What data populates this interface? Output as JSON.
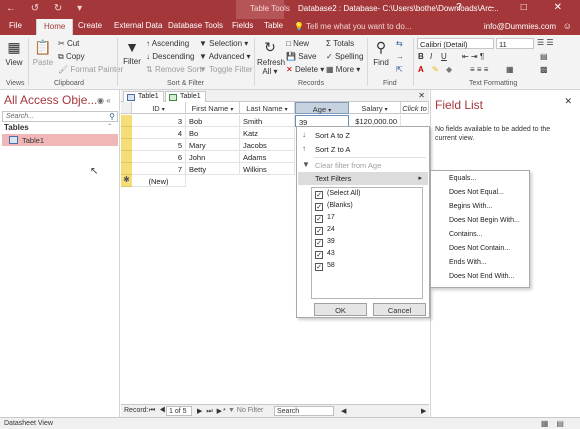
{
  "titlebar": {
    "quick_access": "← ↺ ↻ ▾",
    "tool_context": "Table Tools",
    "window_title": "Database2 : Database- C:\\Users\\bothe\\Downloads\\Arc...",
    "window_controls": "? – □ ✕"
  },
  "tabs": {
    "file": "File",
    "home": "Home",
    "create": "Create",
    "external": "External Data",
    "dbtools": "Database Tools",
    "fields": "Fields",
    "table": "Table",
    "tell": "Tell me what you want to do...",
    "email": "info@Dummies.com"
  },
  "ribbon": {
    "views": {
      "view": "View",
      "group": "Views"
    },
    "clipboard": {
      "paste": "Paste",
      "cut": "Cut",
      "copy": "Copy",
      "format_painter": "Format Painter",
      "group": "Clipboard"
    },
    "sortfilter": {
      "filter": "Filter",
      "ascending": "Ascending",
      "descending": "Descending",
      "remove_sort": "Remove Sort",
      "selection": "Selection ▾",
      "advanced": "Advanced ▾",
      "toggle_filter": "Toggle Filter",
      "group": "Sort & Filter"
    },
    "records": {
      "refresh": "Refresh All ▾",
      "new": "New",
      "save": "Save",
      "delete": "Delete ▾",
      "totals": "Totals",
      "spelling": "Spelling",
      "more": "More ▾",
      "group": "Records"
    },
    "find": {
      "find": "Find",
      "group": "Find"
    },
    "textformat": {
      "font": "Calibri (Detail)",
      "size": "11",
      "group": "Text Formatting"
    }
  },
  "navpane": {
    "title": "All Access Obje...",
    "search_placeholder": "Search...",
    "section": "Tables",
    "item": "Table1"
  },
  "doctabs": {
    "tab1": "Table1",
    "tab2": "Table1"
  },
  "datasheet": {
    "columns": [
      "ID",
      "First Name",
      "Last Name",
      "Age",
      "Salary",
      "Click to"
    ],
    "rows": [
      {
        "id": "3",
        "first": "Bob",
        "last": "Smith",
        "age": "39",
        "salary": "$120,000.00"
      },
      {
        "id": "4",
        "first": "Bo",
        "last": "Katz",
        "age": "",
        "salary": ""
      },
      {
        "id": "5",
        "first": "Mary",
        "last": "Jacobs",
        "age": "",
        "salary": ""
      },
      {
        "id": "6",
        "first": "John",
        "last": "Adams",
        "age": "",
        "salary": ""
      },
      {
        "id": "7",
        "first": "Betty",
        "last": "Wilkins",
        "age": "",
        "salary": ""
      }
    ],
    "new_row": "(New)",
    "new_row_marker": "✱"
  },
  "recnav": {
    "label": "Record:",
    "position": "1 of 5",
    "nofilter": "No Filter",
    "search": "Search"
  },
  "filtermenu": {
    "sort_az": "Sort A to Z",
    "sort_za": "Sort Z to A",
    "clear_filter": "Clear filter from Age",
    "text_filters": "Text Filters",
    "checks": [
      "(Select All)",
      "(Blanks)",
      "17",
      "24",
      "39",
      "43",
      "58"
    ],
    "ok": "OK",
    "cancel": "Cancel"
  },
  "submenu": [
    "Equals...",
    "Does Not Equal...",
    "Begins With...",
    "Does Not Begin With...",
    "Contains...",
    "Does Not Contain...",
    "Ends With...",
    "Does Not End With..."
  ],
  "fieldlist": {
    "title": "Field List",
    "message": "No fields available to be added to the current view."
  },
  "statusbar": {
    "text": "Datasheet View"
  },
  "colors": {
    "accent": "#a4373a",
    "row_selector": "#f5dd7a",
    "nav_item": "#f1b7b8"
  }
}
